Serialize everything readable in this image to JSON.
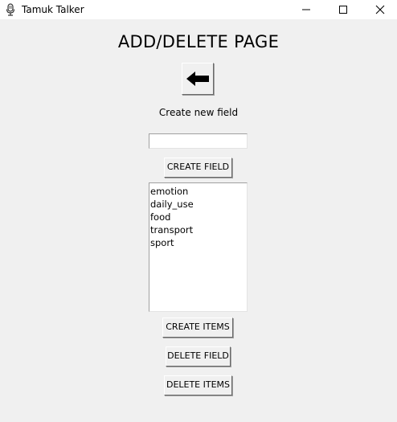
{
  "window": {
    "title": "Tamuk Talker",
    "icon": "microphone-icon"
  },
  "page": {
    "heading": "ADD/DELETE PAGE",
    "back_icon": "arrow-left-icon",
    "create_label": "Create new field",
    "field_input_value": ""
  },
  "buttons": {
    "create_field": "CREATE FIELD",
    "create_items": "CREATE ITEMS",
    "delete_field": "DELETE FIELD",
    "delete_items": "DELETE ITEMS"
  },
  "fields_list": {
    "items": [
      "emotion",
      "daily_use",
      "food",
      "transport",
      "sport"
    ]
  }
}
